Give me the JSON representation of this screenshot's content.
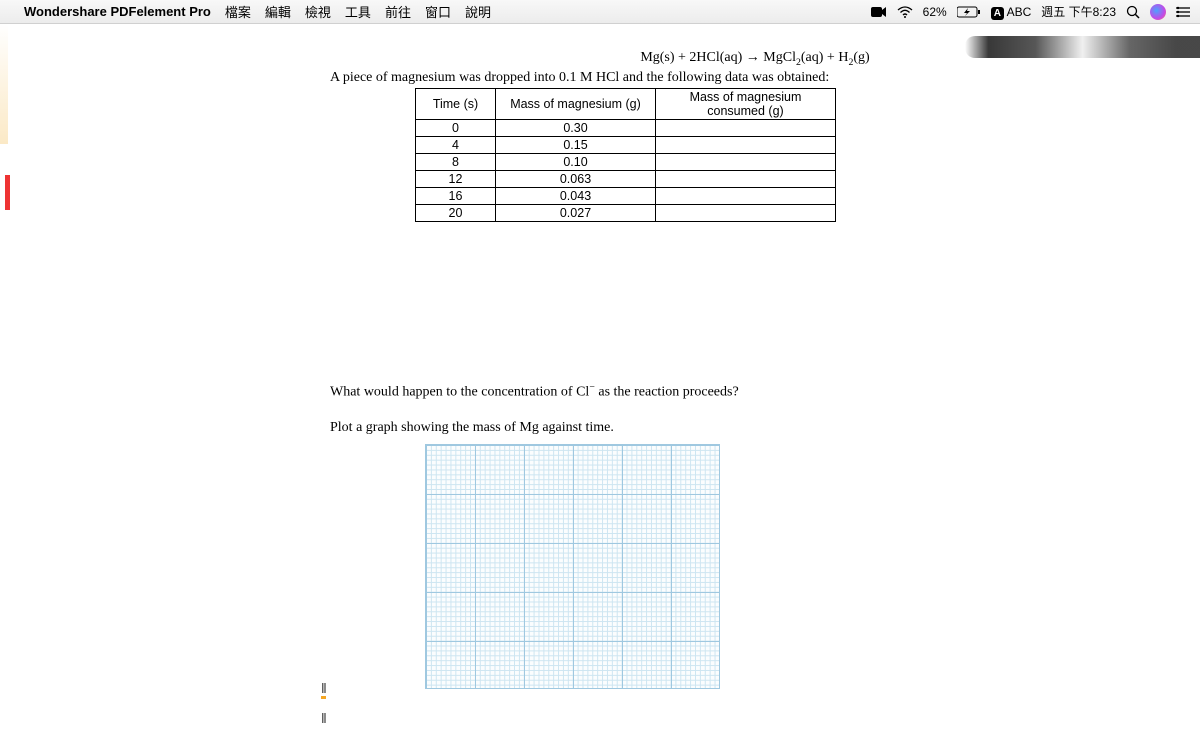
{
  "menubar": {
    "app_name": "Wondershare PDFelement Pro",
    "menus": [
      "檔案",
      "編輯",
      "檢視",
      "工具",
      "前往",
      "窗口",
      "說明"
    ]
  },
  "status": {
    "battery": "62%",
    "input": "ABC",
    "datetime": "週五 下午8:23"
  },
  "document": {
    "equation_html": "Mg(s) + 2HCl(aq) → MgCl<sub>2</sub>(aq) + H<sub>2</sub>(g)",
    "intro": "A piece of magnesium was dropped into 0.1 M HCl and the following data was obtained:",
    "table": {
      "headers": [
        "Time (s)",
        "Mass of magnesium (g)",
        "Mass of magnesium consumed (g)"
      ],
      "rows": [
        {
          "time": "0",
          "mass": "0.30",
          "consumed": ""
        },
        {
          "time": "4",
          "mass": "0.15",
          "consumed": ""
        },
        {
          "time": "8",
          "mass": "0.10",
          "consumed": ""
        },
        {
          "time": "12",
          "mass": "0.063",
          "consumed": ""
        },
        {
          "time": "16",
          "mass": "0.043",
          "consumed": ""
        },
        {
          "time": "20",
          "mass": "0.027",
          "consumed": ""
        }
      ]
    },
    "question_html": "What would happen to the concentration of Cl<sup>−</sup> as the reaction proceeds?",
    "plot_instruction": "Plot a graph showing the mass of Mg against time."
  }
}
